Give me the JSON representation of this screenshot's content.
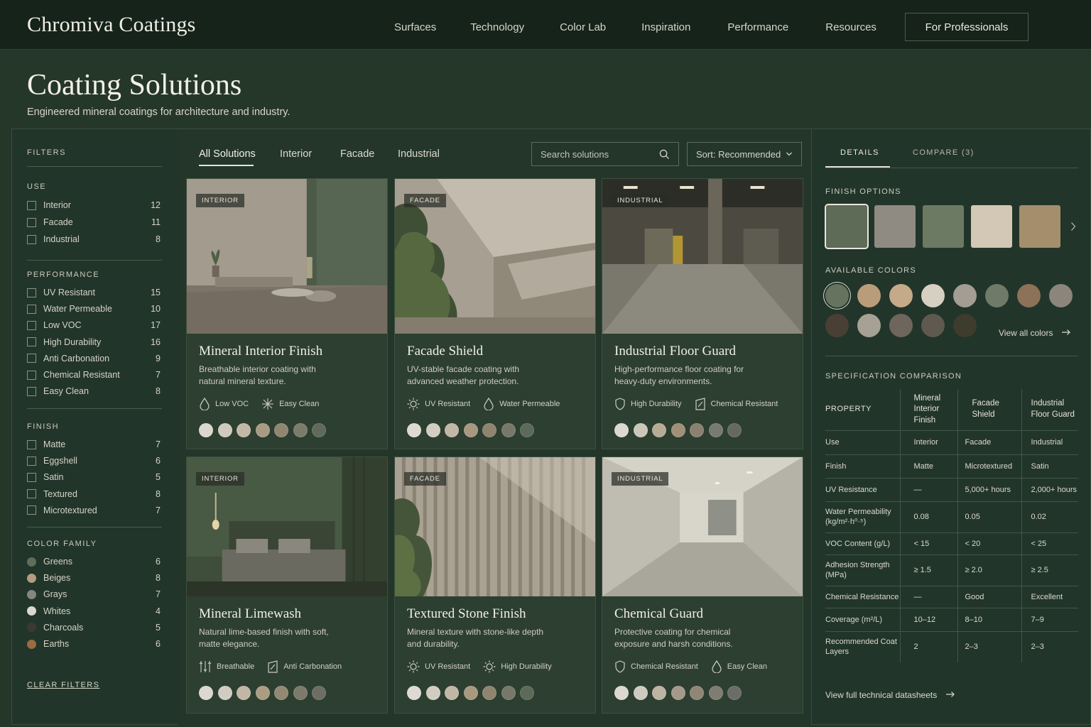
{
  "brand": "Chromiva Coatings",
  "nav": [
    "Surfaces",
    "Technology",
    "Color Lab",
    "Inspiration",
    "Performance",
    "Resources"
  ],
  "pro_button": "For Professionals",
  "header": {
    "title": "Coating Solutions",
    "subtitle": "Engineered mineral coatings for architecture and industry."
  },
  "filters": {
    "title": "FILTERS",
    "use": {
      "title": "USE",
      "items": [
        {
          "label": "Interior",
          "count": "12"
        },
        {
          "label": "Facade",
          "count": "11"
        },
        {
          "label": "Industrial",
          "count": "8"
        }
      ]
    },
    "performance": {
      "title": "PERFORMANCE",
      "items": [
        {
          "label": "UV Resistant",
          "count": "15"
        },
        {
          "label": "Water Permeable",
          "count": "10"
        },
        {
          "label": "Low VOC",
          "count": "17"
        },
        {
          "label": "High Durability",
          "count": "16"
        },
        {
          "label": "Anti Carbonation",
          "count": "9"
        },
        {
          "label": "Chemical Resistant",
          "count": "7"
        },
        {
          "label": "Easy Clean",
          "count": "8"
        }
      ]
    },
    "finish": {
      "title": "FINISH",
      "items": [
        {
          "label": "Matte",
          "count": "7"
        },
        {
          "label": "Eggshell",
          "count": "6"
        },
        {
          "label": "Satin",
          "count": "5"
        },
        {
          "label": "Textured",
          "count": "8"
        },
        {
          "label": "Microtextured",
          "count": "7"
        }
      ]
    },
    "color_family": {
      "title": "COLOR FAMILY",
      "items": [
        {
          "label": "Greens",
          "count": "6",
          "color": "#5d6f58"
        },
        {
          "label": "Beiges",
          "count": "8",
          "color": "#b39d7e"
        },
        {
          "label": "Grays",
          "count": "7",
          "color": "#85877f"
        },
        {
          "label": "Whites",
          "count": "4",
          "color": "#dcd8cf"
        },
        {
          "label": "Charcoals",
          "count": "5",
          "color": "#3a3a33"
        },
        {
          "label": "Earths",
          "count": "6",
          "color": "#9a6b40"
        }
      ]
    },
    "clear_label": "CLEAR FILTERS"
  },
  "tabs": [
    "All Solutions",
    "Interior",
    "Facade",
    "Industrial"
  ],
  "search": {
    "placeholder": "Search solutions"
  },
  "sort": {
    "label": "Sort: Recommended"
  },
  "cards": [
    {
      "badge": "INTERIOR",
      "title": "Mineral Interior Finish",
      "desc": "Breathable interior coating with natural mineral texture.",
      "tags": [
        {
          "label": "Low VOC",
          "icon": "droplet-icon"
        },
        {
          "label": "Easy Clean",
          "icon": "sparkle-icon"
        }
      ],
      "swatches": [
        "#dcd7cd",
        "#d0c9bc",
        "#c3b8a6",
        "#a99a83",
        "#8f8672",
        "#7b7b6c",
        "#5f6b5a"
      ]
    },
    {
      "badge": "FACADE",
      "title": "Facade Shield",
      "desc": "UV-stable facade coating with advanced weather protection.",
      "tags": [
        {
          "label": "UV Resistant",
          "icon": "sun-icon"
        },
        {
          "label": "Water Permeable",
          "icon": "droplet-icon"
        }
      ],
      "swatches": [
        "#dedad2",
        "#d3cdc1",
        "#c2b7a6",
        "#a8987f",
        "#8e8470",
        "#77786a",
        "#5d6a5a"
      ]
    },
    {
      "badge": "INDUSTRIAL",
      "title": "Industrial Floor Guard",
      "desc": "High-performance floor coating for heavy-duty environments.",
      "tags": [
        {
          "label": "High Durability",
          "icon": "shield-icon"
        },
        {
          "label": "Chemical Resistant",
          "icon": "flask-icon"
        }
      ],
      "swatches": [
        "#dcd8cf",
        "#ccc6b9",
        "#b8ab96",
        "#a09079",
        "#8a8170",
        "#787a70",
        "#66695f"
      ]
    },
    {
      "badge": "INTERIOR",
      "title": "Mineral Limewash",
      "desc": "Natural lime-based finish with soft, matte elegance.",
      "tags": [
        {
          "label": "Breathable",
          "icon": "breathable-icon"
        },
        {
          "label": "Anti Carbonation",
          "icon": "shield-icon"
        }
      ],
      "swatches": [
        "#dcd8cf",
        "#d2ccc0",
        "#c2b7a6",
        "#ab9c84",
        "#938874",
        "#7d7a6c",
        "#6c6d63"
      ]
    },
    {
      "badge": "FACADE",
      "title": "Textured Stone Finish",
      "desc": "Mineral texture with stone-like depth and durability.",
      "tags": [
        {
          "label": "UV Resistant",
          "icon": "sun-icon"
        },
        {
          "label": "High Durability",
          "icon": "sun-icon"
        }
      ],
      "swatches": [
        "#dedad2",
        "#d3cdc1",
        "#c2b7a6",
        "#a8987f",
        "#8e8470",
        "#77786a",
        "#5d6a5a"
      ]
    },
    {
      "badge": "INDUSTRIAL",
      "title": "Chemical Guard",
      "desc": "Protective coating for chemical exposure and harsh conditions.",
      "tags": [
        {
          "label": "Chemical Resistant",
          "icon": "shield-icon"
        },
        {
          "label": "Easy Clean",
          "icon": "droplet-icon"
        }
      ],
      "swatches": [
        "#dcd8cf",
        "#d0cbc0",
        "#bdb3a2",
        "#a6988a",
        "#908676",
        "#7f7c72",
        "#6c6d66"
      ]
    }
  ],
  "details": {
    "tabs": [
      "DETAILS",
      "COMPARE (3)"
    ],
    "finish_title": "FINISH OPTIONS",
    "finishes": [
      "#5e6b57",
      "#8f8a82",
      "#6c7a63",
      "#d3c8b5",
      "#a58e6c"
    ],
    "colors_title": "AVAILABLE COLORS",
    "colors": [
      "#66745f",
      "#b99d7b",
      "#c4aa89",
      "#d7cfc2",
      "#a39d93",
      "#6f7a69",
      "#8c7259",
      "#8b857b",
      "#4a3f35",
      "#a7a195",
      "#6e665c",
      "#5f5950",
      "#3e3c2c"
    ],
    "view_colors": "View all colors",
    "spec_title": "SPECIFICATION COMPARISON",
    "spec": {
      "headers": [
        "PROPERTY",
        "Mineral Interior Finish",
        "Facade Shield",
        "Industrial Floor Guard"
      ],
      "rows": [
        [
          "Use",
          "Interior",
          "Facade",
          "Industrial"
        ],
        [
          "Finish",
          "Matte",
          "Microtextured",
          "Satin"
        ],
        [
          "UV Resistance",
          "—",
          "5,000+ hours",
          "2,000+ hours"
        ],
        [
          "Water Permeability (kg/m²·h⁰·⁵)",
          "0.08",
          "0.05",
          "0.02"
        ],
        [
          "VOC Content (g/L)",
          "< 15",
          "< 20",
          "< 25"
        ],
        [
          "Adhesion Strength (MPa)",
          "≥ 1.5",
          "≥ 2.0",
          "≥ 2.5"
        ],
        [
          "Chemical Resistance",
          "—",
          "Good",
          "Excellent"
        ],
        [
          "Coverage (m²/L)",
          "10–12",
          "8–10",
          "7–9"
        ],
        [
          "Recommended Coat Layers",
          "2",
          "2–3",
          "2–3"
        ]
      ]
    },
    "datasheets": "View full technical datasheets"
  }
}
